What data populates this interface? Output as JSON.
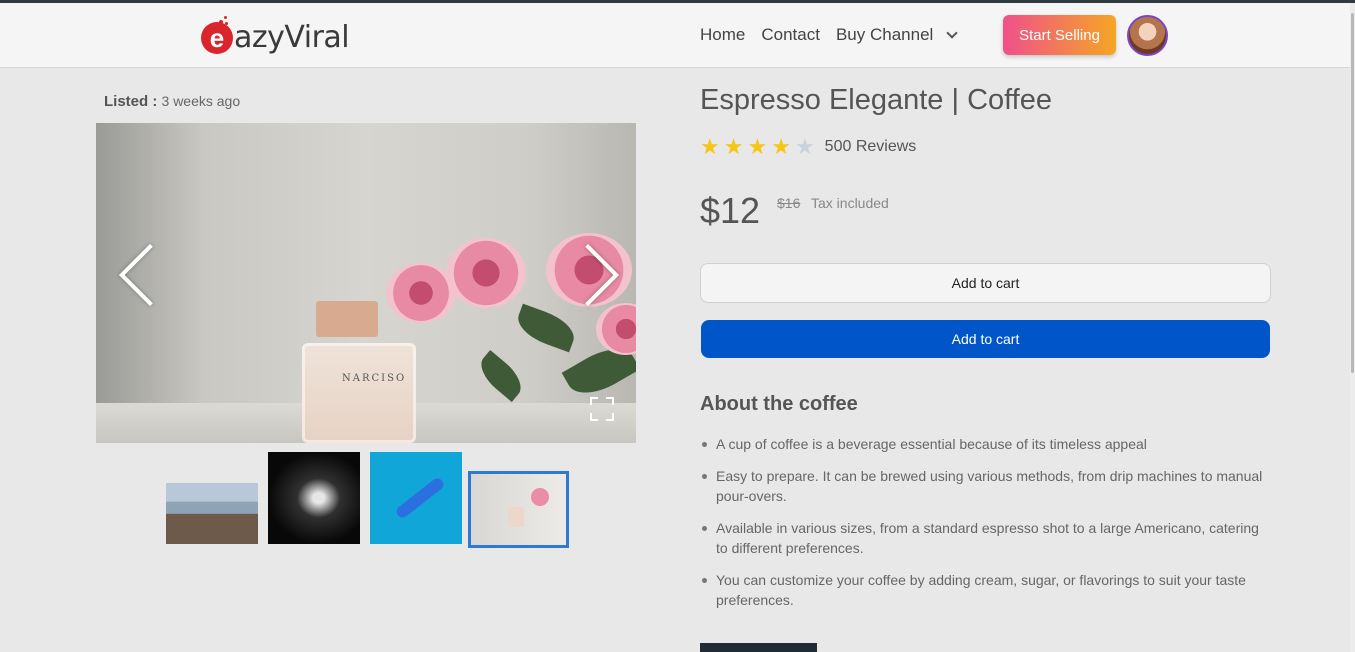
{
  "brand": {
    "logo_letter": "e",
    "logo_text": "azyViral"
  },
  "nav": {
    "items": [
      "Home",
      "Contact",
      "Buy Channel"
    ],
    "start_selling": "Start Selling"
  },
  "listing": {
    "label": "Listed :",
    "value": "3 weeks ago"
  },
  "gallery": {
    "main_image": "perfume-bottle-with-roses",
    "bottle_label": "NARCISO",
    "thumbnails": [
      "beach-rocks",
      "black-mascara",
      "blue-pen",
      "perfume-roses"
    ],
    "active_thumbnail": 3
  },
  "product": {
    "title": "Espresso Elegante | Coffee",
    "rating": 4,
    "rating_max": 5,
    "reviews": "500 Reviews",
    "price": "$12",
    "old_price": "$16",
    "tax_note": "Tax included",
    "add_to_cart_outline": "Add to cart",
    "add_to_cart_primary": "Add to cart"
  },
  "about": {
    "title": "About the coffee",
    "points": [
      "A cup of coffee is a beverage essential because of its timeless appeal",
      "Easy to prepare. It can be brewed using various methods, from drip machines to manual pour-overs.",
      "Available in various sizes, from a standard espresso shot to a large Americano, catering to different preferences.",
      "You can customize your coffee by adding cream, sugar, or flavorings to suit your taste preferences."
    ]
  },
  "colors": {
    "primary_button": "#0056c9",
    "star_on": "#f5c518",
    "star_off": "#c9d3db",
    "brand_red": "#d9262c",
    "sell_gradient_start": "#f0508a",
    "sell_gradient_end": "#f5a623"
  }
}
